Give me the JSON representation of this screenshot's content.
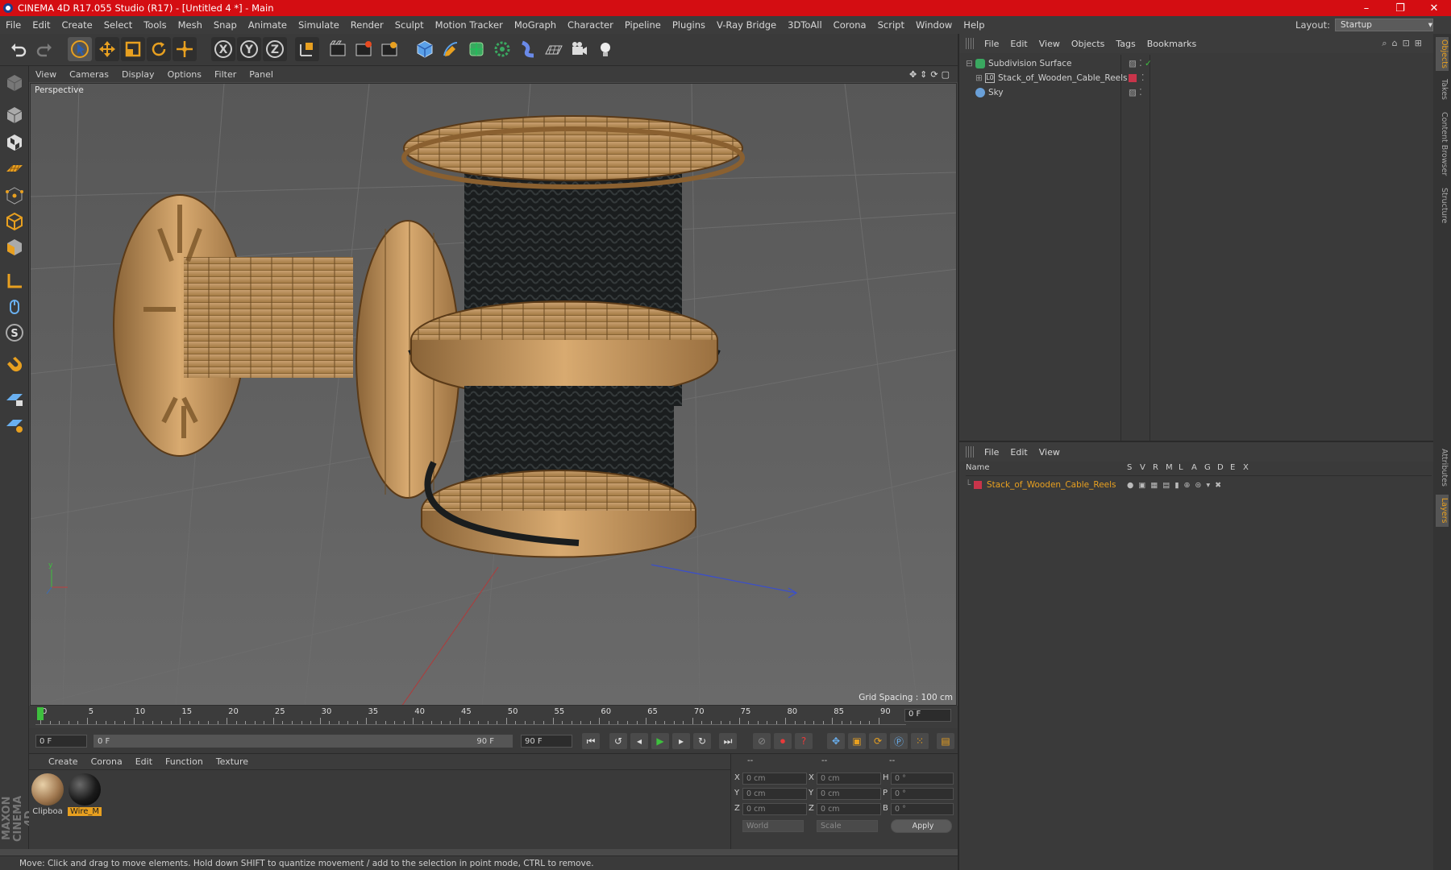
{
  "titlebar": {
    "title": "CINEMA 4D R17.055 Studio (R17) - [Untitled 4 *] - Main",
    "min": "–",
    "max": "❐",
    "close": "✕"
  },
  "menu": [
    "File",
    "Edit",
    "Create",
    "Select",
    "Tools",
    "Mesh",
    "Snap",
    "Animate",
    "Simulate",
    "Render",
    "Sculpt",
    "Motion Tracker",
    "MoGraph",
    "Character",
    "Pipeline",
    "Plugins",
    "V-Ray Bridge",
    "3DToAll",
    "Corona",
    "Script",
    "Window",
    "Help"
  ],
  "layout": {
    "label": "Layout:",
    "value": "Startup"
  },
  "toolbar_icons": [
    "undo-icon",
    "redo-icon",
    "select-arrow-icon",
    "move-icon",
    "scale-icon",
    "rotate-icon",
    "transform-icon",
    "x-axis-icon",
    "y-axis-icon",
    "z-axis-icon",
    "coordinate-system-icon",
    "render-view-icon",
    "render-picture-viewer-icon",
    "edit-render-settings-icon",
    "cube-icon",
    "pen-icon",
    "subdivision-icon",
    "array-icon",
    "deformer-icon",
    "floor-icon",
    "camera-icon",
    "light-icon"
  ],
  "viewport": {
    "menu": [
      "View",
      "Cameras",
      "Display",
      "Options",
      "Filter",
      "Panel"
    ],
    "label": "Perspective",
    "grid_spacing": "Grid Spacing : 100 cm"
  },
  "timeline": {
    "ticks": [
      "0",
      "5",
      "10",
      "15",
      "20",
      "25",
      "30",
      "35",
      "40",
      "45",
      "50",
      "55",
      "60",
      "65",
      "70",
      "75",
      "80",
      "85",
      "90"
    ],
    "current_frame": "0 F",
    "start_field": "0 F",
    "range_start": "0 F",
    "range_end": "90 F",
    "end_field": "90 F"
  },
  "materials": {
    "menu": [
      "Create",
      "Corona",
      "Edit",
      "Function",
      "Texture"
    ],
    "items": [
      {
        "name": "Clipboa"
      },
      {
        "name": "Wire_M"
      }
    ]
  },
  "coords": {
    "headers": [
      "--",
      "--",
      "--"
    ],
    "rows": [
      {
        "a": "X",
        "av": "0 cm",
        "b": "X",
        "bv": "0 cm",
        "c": "H",
        "cv": "0 °"
      },
      {
        "a": "Y",
        "av": "0 cm",
        "b": "Y",
        "bv": "0 cm",
        "c": "P",
        "cv": "0 °"
      },
      {
        "a": "Z",
        "av": "0 cm",
        "b": "Z",
        "bv": "0 cm",
        "c": "B",
        "cv": "0 °"
      }
    ],
    "mode1": "World",
    "mode2": "Scale",
    "apply": "Apply"
  },
  "status": "Move: Click and drag to move elements. Hold down SHIFT to quantize movement / add to the selection in point mode, CTRL to remove.",
  "object_manager": {
    "menu": [
      "File",
      "Edit",
      "View",
      "Objects",
      "Tags",
      "Bookmarks"
    ],
    "objects": [
      {
        "name": "Subdivision Surface"
      },
      {
        "name": "Stack_of_Wooden_Cable_Reels"
      },
      {
        "name": "Sky"
      }
    ]
  },
  "layer_manager": {
    "menu": [
      "File",
      "Edit",
      "View"
    ],
    "columns": [
      "Name",
      "S",
      "V",
      "R",
      "M",
      "L",
      "A",
      "G",
      "D",
      "E",
      "X"
    ],
    "layers": [
      {
        "name": "Stack_of_Wooden_Cable_Reels"
      }
    ]
  },
  "right_tabs": [
    "Objects",
    "Takes",
    "Content Browser",
    "Structure",
    "Attributes",
    "Layers"
  ],
  "maxon": "MAXON CINEMA 4D",
  "colors": {
    "accent": "#e8a020",
    "title_red": "#d40d12",
    "layer_red": "#c8344a"
  }
}
